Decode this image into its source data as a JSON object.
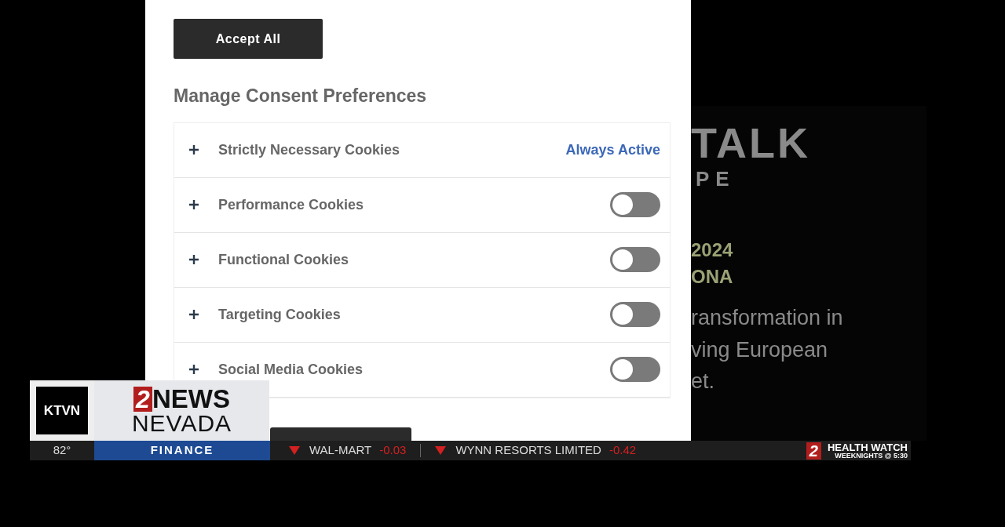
{
  "dialog": {
    "accept_button": "Accept All",
    "heading": "Manage Consent Preferences",
    "categories": [
      {
        "kind": "always",
        "label": "Strictly Necessary Cookies",
        "status": "Always Active"
      },
      {
        "kind": "toggle",
        "label": "Performance Cookies",
        "on": false
      },
      {
        "kind": "toggle",
        "label": "Functional Cookies",
        "on": false
      },
      {
        "kind": "toggle",
        "label": "Targeting Cookies",
        "on": false
      },
      {
        "kind": "toggle",
        "label": "Social Media Cookies",
        "on": false
      }
    ]
  },
  "background_page": {
    "logo_word": "TALK",
    "logo_sub": "PE",
    "date": "2024",
    "city": "ONA",
    "lines": [
      "ransformation in",
      "ving European",
      "et."
    ]
  },
  "broadcast": {
    "station": "KTVN",
    "brand_number": "2",
    "brand_word": "NEWS",
    "brand_region": "NEVADA",
    "temperature": "82°",
    "segment": "FINANCE",
    "ticker": [
      {
        "name": "WAL-MART",
        "change": "-0.03"
      },
      {
        "name": "WYNN RESORTS LIMITED",
        "change": "-0.42"
      }
    ],
    "promo": {
      "number": "2",
      "title": "HEALTH WATCH",
      "subtitle": "WEEKNIGHTS @ 5:30"
    }
  }
}
